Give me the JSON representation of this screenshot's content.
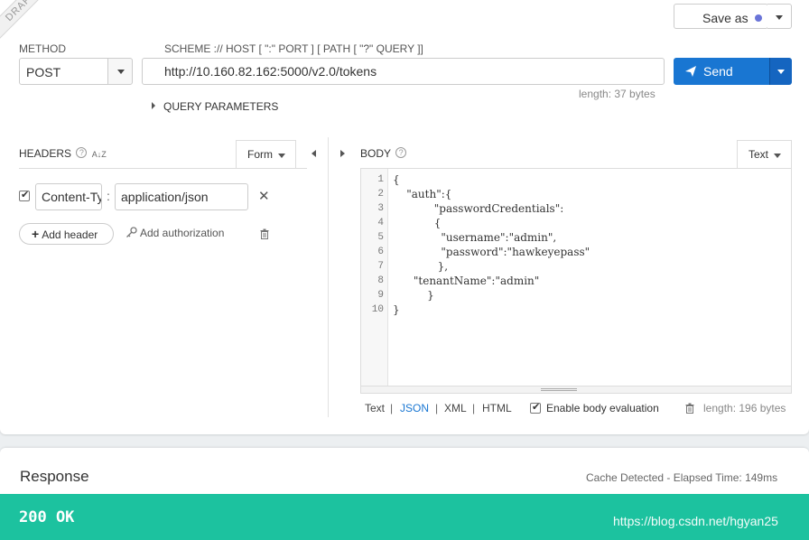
{
  "draft_label": "DRAFT",
  "save": {
    "label": "Save as"
  },
  "method": {
    "label": "METHOD",
    "value": "POST"
  },
  "url": {
    "scheme_label": "SCHEME :// HOST [ \":\" PORT ] [ PATH [ \"?\" QUERY ]]",
    "value": "http://10.160.82.162:5000/v2.0/tokens",
    "length": "length: 37 bytes"
  },
  "send": {
    "label": "Send"
  },
  "query_params": {
    "label": "QUERY PARAMETERS"
  },
  "headers": {
    "label": "HEADERS",
    "sort_icon": "A↓Z",
    "mode_tab": "Form",
    "items": [
      {
        "name": "Content-Type",
        "value": "application/json",
        "enabled": true
      }
    ],
    "add_header_label": "Add header",
    "add_auth_label": "Add authorization"
  },
  "body": {
    "label": "BODY",
    "mode_tab": "Text",
    "line_numbers": [
      "1",
      "2",
      "3",
      "4",
      "5",
      "6",
      "7",
      "8",
      "9",
      "10"
    ],
    "lines": [
      "{",
      "    \"auth\":{",
      "            \"passwordCredentials\":",
      "            {",
      "              \"username\":\"admin\",",
      "              \"password\":\"hawkeyepass\"",
      "             },",
      "      \"tenantName\":\"admin\"",
      "          }",
      "}"
    ],
    "formats": [
      "Text",
      "JSON",
      "XML",
      "HTML"
    ],
    "active_format": "JSON",
    "enable_eval_label": "Enable body evaluation",
    "length": "length: 196 bytes"
  },
  "response": {
    "title": "Response",
    "meta": "Cache Detected - Elapsed Time: 149ms",
    "status": "200 OK",
    "watermark": "https://blog.csdn.net/hgyan25"
  },
  "colors": {
    "accent": "#1976d2",
    "status_ok": "#1cc29f",
    "unsaved_dot": "#6a74d8"
  }
}
